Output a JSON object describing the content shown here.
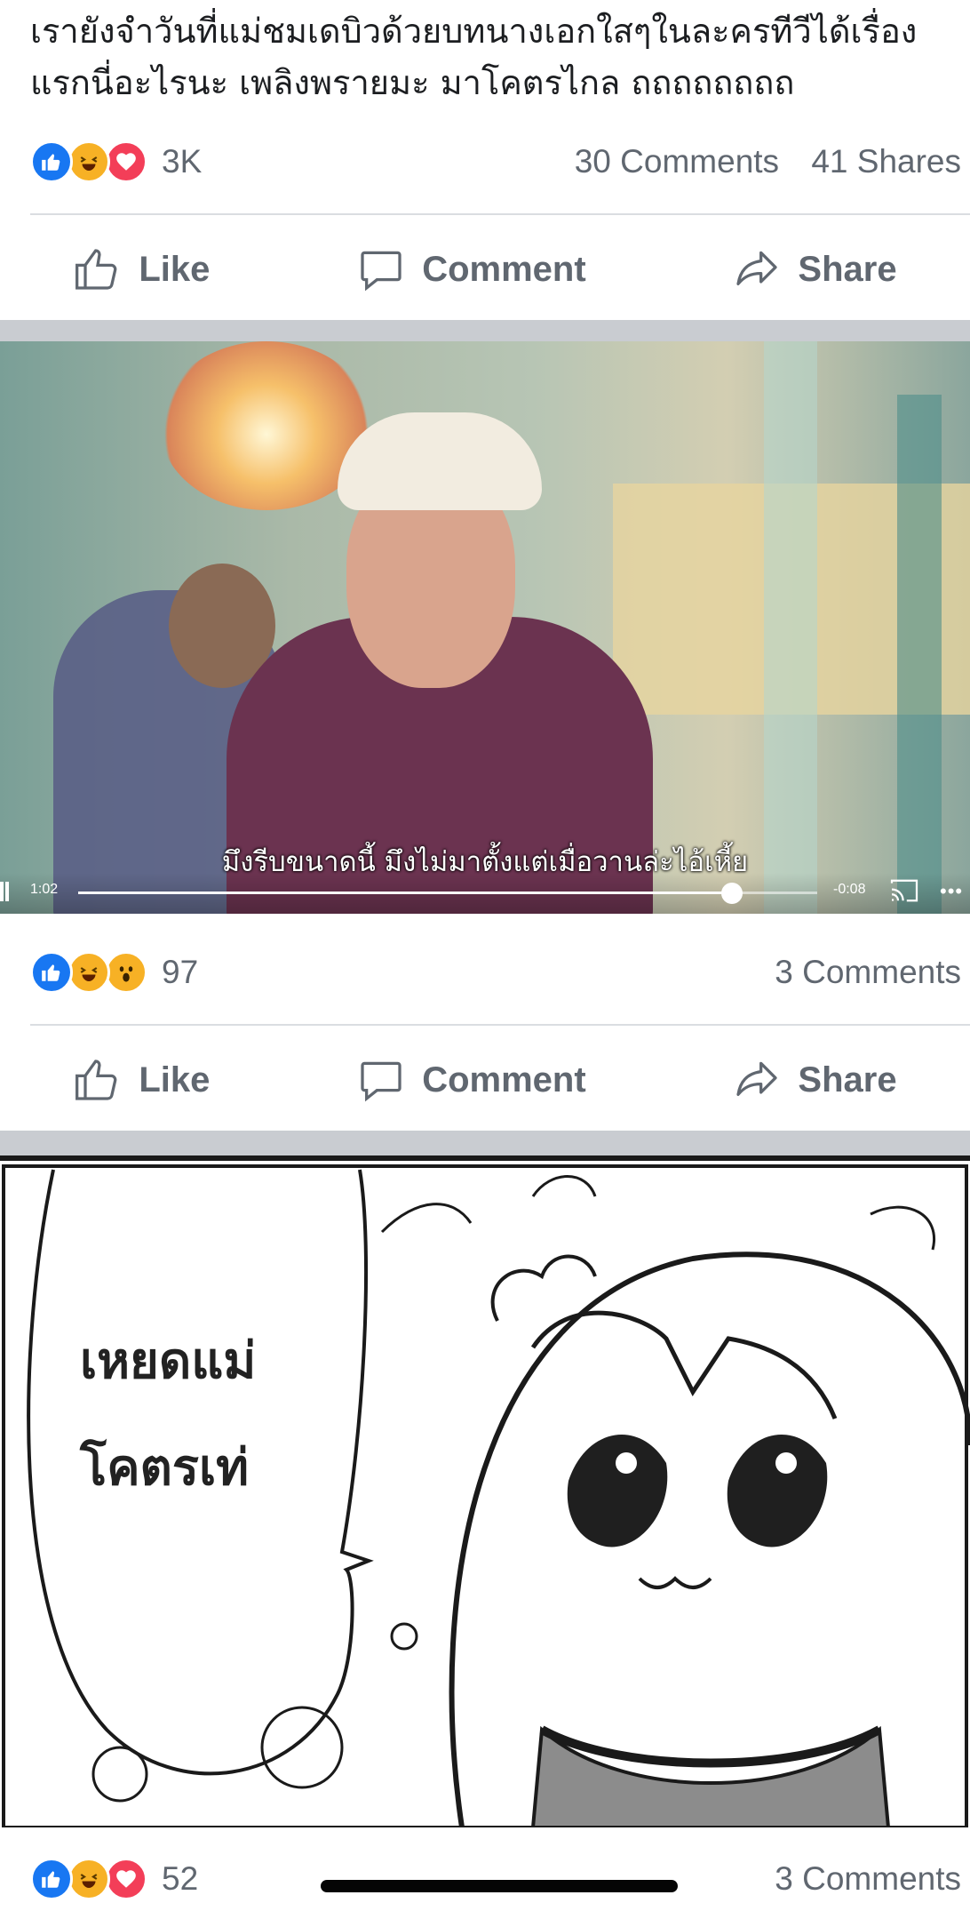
{
  "posts": [
    {
      "text": "เรายังจำวันที่แม่ชมเดบิวด้วยบทนางเอกใสๆในละครทีวีได้เรื่องแรกนี่อะไรนะ เพลิงพรายมะ มาโคตรไกล ถถถถถถถถ",
      "reaction_icons": [
        "like-icon",
        "haha-icon",
        "love-icon"
      ],
      "reaction_count": "3K",
      "comments": "30 Comments",
      "shares": "41 Shares"
    },
    {
      "reaction_icons": [
        "like-icon",
        "haha-icon",
        "wow-icon"
      ],
      "reaction_count": "97",
      "comments": "3 Comments",
      "video": {
        "subtitle": "มึงรีบขนาดนี้ มึงไม่มาตั้งแต่เมื่อวานล่ะไอ้เหี้ย",
        "elapsed": "1:02",
        "remaining": "-0:08",
        "progress": 0.885
      }
    },
    {
      "comic_lines": [
        "เหยดแม่",
        "โคตรเท่"
      ],
      "reaction_icons": [
        "like-icon",
        "haha-icon",
        "love-icon"
      ],
      "reaction_count": "52",
      "comments": "3 Comments"
    }
  ],
  "actions": {
    "like": "Like",
    "comment": "Comment",
    "share": "Share"
  },
  "colors": {
    "fb_blue": "#1877f2",
    "haha_yellow": "#f7b125",
    "love_red": "#f33e58",
    "meta_gray": "#606770",
    "separator": "#c9ccd1"
  }
}
